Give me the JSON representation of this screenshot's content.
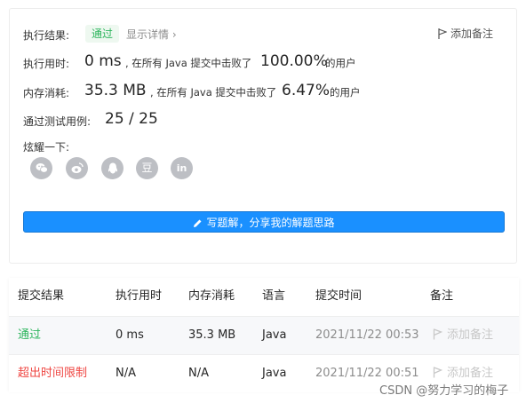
{
  "result": {
    "label": "执行结果:",
    "status": "通过",
    "detail_link": "显示详情 ›",
    "add_note": "添加备注"
  },
  "runtime": {
    "label": "执行用时:",
    "value": "0 ms",
    "text_before": ", 在所有 Java 提交中击败了",
    "percent": "100.00%",
    "text_after": "的用户"
  },
  "memory": {
    "label": "内存消耗:",
    "value": "35.3 MB",
    "text_before": ", 在所有 Java 提交中击败了",
    "percent": "6.47%",
    "text_after": "的用户"
  },
  "testcases": {
    "label": "通过测试用例:",
    "value": "25 / 25"
  },
  "share": {
    "label": "炫耀一下:",
    "icons": [
      "wechat-icon",
      "weibo-icon",
      "qq-icon",
      "douban-icon",
      "linkedin-icon"
    ],
    "douban_glyph": "豆",
    "linkedin_glyph": "in"
  },
  "write_button": "写题解，分享我的解题思路",
  "table": {
    "headers": [
      "提交结果",
      "执行用时",
      "内存消耗",
      "语言",
      "提交时间",
      "备注"
    ],
    "rows": [
      {
        "result": "通过",
        "runtime": "0 ms",
        "memory": "35.3 MB",
        "lang": "Java",
        "time": "2021/11/22 00:53",
        "note": "添加备注"
      },
      {
        "result": "超出时间限制",
        "runtime": "N/A",
        "memory": "N/A",
        "lang": "Java",
        "time": "2021/11/22 00:51",
        "note": "添加备注"
      }
    ]
  },
  "watermark": "CSDN @努力学习的梅子",
  "colors": {
    "accent": "#1a90ff",
    "success": "#2db55d",
    "error": "#ef4743"
  }
}
